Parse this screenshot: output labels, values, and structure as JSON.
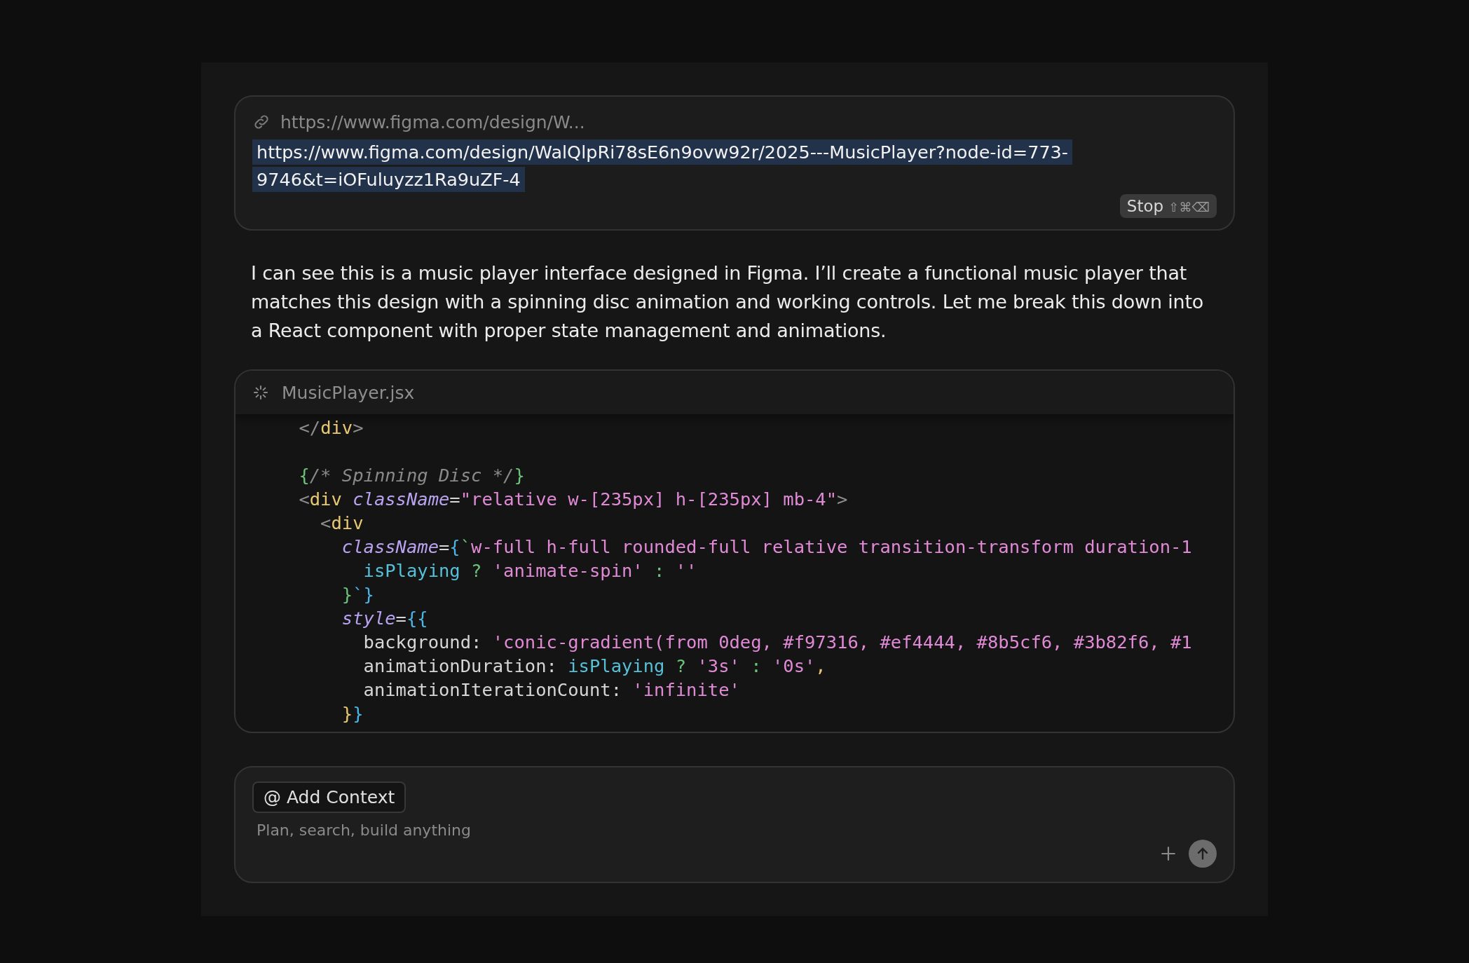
{
  "url_card": {
    "header": "https://www.figma.com/design/W...",
    "url_lines": [
      "https://www.figma.com/design/WalQlpRi78sE6n9ovw92r/2025---MusicPlayer?node-id=773-",
      "9746&t=iOFuluyzz1Ra9uZF-4"
    ],
    "stop_button": {
      "label": "Stop",
      "shortcut": "⇧⌘⌫"
    }
  },
  "message": "I can see this is a music player interface designed in Figma. I’ll create a functional music player that matches this design with a spinning disc animation and working controls. Let me break this down into a React component with proper state management and animations.",
  "code_card": {
    "filename": "MusicPlayer.jsx",
    "lines": [
      [
        {
          "kind": "punct",
          "text": "    </"
        },
        {
          "kind": "tag",
          "text": "div"
        },
        {
          "kind": "punct",
          "text": ">"
        }
      ],
      [
        {
          "kind": "blank"
        }
      ],
      [
        {
          "kind": "brace",
          "text": "    {"
        },
        {
          "kind": "comment",
          "text": "/* Spinning Disc */"
        },
        {
          "kind": "brace",
          "text": "}"
        }
      ],
      [
        {
          "kind": "punct",
          "text": "    <"
        },
        {
          "kind": "tag",
          "text": "div"
        },
        {
          "kind": "attr",
          "text": " className"
        },
        {
          "kind": "plain",
          "text": "="
        },
        {
          "kind": "string",
          "text": "\"relative w-[235px] h-[235px] mb-4\""
        },
        {
          "kind": "punct",
          "text": ">"
        }
      ],
      [
        {
          "kind": "punct",
          "text": "      <"
        },
        {
          "kind": "tag",
          "text": "div"
        }
      ],
      [
        {
          "kind": "attr",
          "text": "        className"
        },
        {
          "kind": "plain",
          "text": "="
        },
        {
          "kind": "brace2",
          "text": "{"
        },
        {
          "kind": "brace",
          "text": "`"
        },
        {
          "kind": "string",
          "text": "w-full h-full rounded-full relative transition-transform duration-1"
        }
      ],
      [
        {
          "kind": "var",
          "text": "          isPlaying"
        },
        {
          "kind": "op",
          "text": " ? "
        },
        {
          "kind": "string",
          "text": "'animate-spin'"
        },
        {
          "kind": "op",
          "text": " : "
        },
        {
          "kind": "string",
          "text": "''"
        }
      ],
      [
        {
          "kind": "brace",
          "text": "        }"
        },
        {
          "kind": "brace2",
          "text": "`}"
        }
      ],
      [
        {
          "kind": "attr",
          "text": "        style"
        },
        {
          "kind": "plain",
          "text": "="
        },
        {
          "kind": "brace2",
          "text": "{{"
        }
      ],
      [
        {
          "kind": "plain",
          "text": "          background: "
        },
        {
          "kind": "string",
          "text": "'conic-gradient(from 0deg, #f97316, #ef4444, #8b5cf6, #3b82f6, #1"
        }
      ],
      [
        {
          "kind": "plain",
          "text": "          animationDuration: "
        },
        {
          "kind": "var",
          "text": "isPlaying"
        },
        {
          "kind": "op",
          "text": " ? "
        },
        {
          "kind": "string",
          "text": "'3s'"
        },
        {
          "kind": "op",
          "text": " : "
        },
        {
          "kind": "string",
          "text": "'0s'"
        },
        {
          "kind": "tag",
          "text": ","
        }
      ],
      [
        {
          "kind": "plain",
          "text": "          animationIterationCount: "
        },
        {
          "kind": "string",
          "text": "'infinite'"
        }
      ],
      [
        {
          "kind": "tag",
          "text": "        }"
        },
        {
          "kind": "brace2",
          "text": "}"
        }
      ]
    ]
  },
  "composer": {
    "context_button": "@ Add Context",
    "placeholder": "Plan, search, build anything"
  }
}
